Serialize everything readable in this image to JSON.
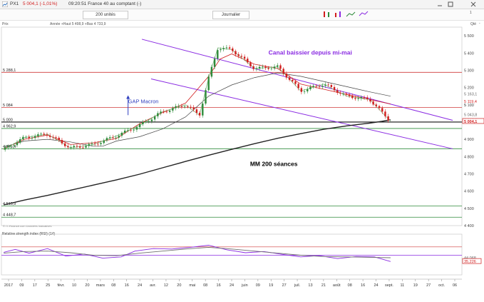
{
  "header": {
    "symbol": "PX1",
    "change": "5 004,1 (-1,01%)",
    "time_desc": "09:20:51 France 40 au comptant (-)",
    "units_label": "200 unités",
    "period_label": "Journalier",
    "window_count": "1"
  },
  "chart_header": {
    "code": "Prix",
    "ohlc_label": "Année +Haut 5 498,9 +Bas 4 733,9",
    "rsi_title": "Relative strength index (RSI) (14)",
    "credits": "© IT-Finance.com Données indicatives",
    "right_labels": [
      "Qté",
      "-"
    ]
  },
  "chart_data": {
    "type": "line",
    "title": "",
    "xlabel": "",
    "ylabel": "",
    "x_ticks": [
      "2017",
      "09",
      "17",
      "25",
      "févr.",
      "10",
      "20",
      "mars",
      "08",
      "16",
      "24",
      "avr.",
      "12",
      "20",
      "mai",
      "08",
      "16",
      "24",
      "juin",
      "09",
      "19",
      "27",
      "juil.",
      "13",
      "21",
      "août",
      "08",
      "16",
      "24",
      "sept.",
      "11",
      "19",
      "27",
      "oct.",
      "06"
    ],
    "ylim": [
      4400,
      5550
    ],
    "y_ticks": [
      "5 500",
      "5 400",
      "5 300",
      "5 200",
      "5 100",
      "5 000",
      "4 900",
      "4 800",
      "4 700",
      "4 600",
      "4 500",
      "4 400"
    ],
    "right_labels": [
      {
        "text": "5 163,1",
        "value": 5163.1,
        "color": "#666666"
      },
      {
        "text": "5 119,4",
        "value": 5119.4,
        "color": "#d11d1d"
      },
      {
        "text": "5 100",
        "value": 5100,
        "color": "#666666"
      },
      {
        "text": "5 043,8",
        "value": 5043.8,
        "color": "#666666"
      },
      {
        "text": "5 013,6",
        "value": 5013.6,
        "color": "#666666"
      },
      {
        "text": "5 004,1",
        "value": 5004.1,
        "color": "#d11d1d",
        "box": true
      }
    ],
    "horizontal_lines": [
      {
        "label": "5 288,1",
        "value": 5288.1,
        "color": "#d13b3b",
        "width": 0.8
      },
      {
        "label": "5 084",
        "value": 5084,
        "color": "#d13b3b",
        "width": 0.8
      },
      {
        "label": "5 000",
        "value": 5000,
        "color": "#111111",
        "width": 1.1
      },
      {
        "label": "4 962,9",
        "value": 4962.9,
        "color": "#2e8b3a",
        "width": 0.8
      },
      {
        "label": "4 845,4",
        "value": 4845.4,
        "color": "#2e8b3a",
        "width": 0.8
      },
      {
        "label": "4 513,9",
        "value": 4513.9,
        "color": "#2e8b3a",
        "width": 0.8
      },
      {
        "label": "4 448,7",
        "value": 4448.7,
        "color": "#2e8b3a",
        "width": 0.8
      }
    ],
    "channel": {
      "color": "#8a2be2",
      "upper": [
        [
          0.305,
          5480
        ],
        [
          0.98,
          5010
        ]
      ],
      "lower": [
        [
          0.325,
          5250
        ],
        [
          0.98,
          4845
        ]
      ]
    },
    "annotations": [
      {
        "text": "Canal baissier depuis mi-mai",
        "value": 5390,
        "xfrac": 0.58,
        "color": "#8a2be2",
        "bold": true
      },
      {
        "text": "GAP Macron",
        "value": 5110,
        "xfrac": 0.275,
        "color": "#2f3fbf",
        "bold": false
      },
      {
        "text": "MM 200 séances",
        "value": 4745,
        "xfrac": 0.54,
        "color": "#000000",
        "bold": true
      }
    ],
    "gap_arrow": {
      "xfrac": 0.275,
      "from": 5040,
      "to": 5155,
      "color": "#2f3fbf"
    },
    "series": [
      {
        "color": "#222222",
        "width": 1.4,
        "values": [
          [
            0.005,
            4520
          ],
          [
            0.05,
            4548
          ],
          [
            0.1,
            4575
          ],
          [
            0.15,
            4605
          ],
          [
            0.2,
            4635
          ],
          [
            0.25,
            4665
          ],
          [
            0.3,
            4698
          ],
          [
            0.35,
            4735
          ],
          [
            0.4,
            4772
          ],
          [
            0.45,
            4808
          ],
          [
            0.5,
            4842
          ],
          [
            0.55,
            4875
          ],
          [
            0.6,
            4906
          ],
          [
            0.65,
            4933
          ],
          [
            0.7,
            4958
          ],
          [
            0.75,
            4978
          ],
          [
            0.8,
            4994
          ],
          [
            0.826,
            5004
          ],
          [
            0.845,
            5013
          ]
        ]
      },
      {
        "color": "#444444",
        "width": 0.7,
        "values": [
          [
            0.005,
            4855
          ],
          [
            0.05,
            4890
          ],
          [
            0.1,
            4900
          ],
          [
            0.15,
            4885
          ],
          [
            0.2,
            4860
          ],
          [
            0.22,
            4860
          ],
          [
            0.25,
            4890
          ],
          [
            0.3,
            4915
          ],
          [
            0.35,
            4960
          ],
          [
            0.4,
            5030
          ],
          [
            0.45,
            5150
          ],
          [
            0.5,
            5215
          ],
          [
            0.55,
            5258
          ],
          [
            0.6,
            5285
          ],
          [
            0.65,
            5265
          ],
          [
            0.7,
            5235
          ],
          [
            0.75,
            5205
          ],
          [
            0.8,
            5175
          ],
          [
            0.845,
            5150
          ]
        ]
      },
      {
        "color": "#d11d1d",
        "width": 0.8,
        "values": [
          [
            0.005,
            4845
          ],
          [
            0.05,
            4900
          ],
          [
            0.1,
            4925
          ],
          [
            0.15,
            4870
          ],
          [
            0.2,
            4880
          ],
          [
            0.25,
            4905
          ],
          [
            0.3,
            4990
          ],
          [
            0.35,
            5055
          ],
          [
            0.4,
            5110
          ],
          [
            0.45,
            5265
          ],
          [
            0.475,
            5365
          ],
          [
            0.5,
            5395
          ],
          [
            0.55,
            5335
          ],
          [
            0.6,
            5310
          ],
          [
            0.65,
            5220
          ],
          [
            0.7,
            5190
          ],
          [
            0.75,
            5160
          ],
          [
            0.8,
            5130
          ],
          [
            0.845,
            5105
          ]
        ]
      },
      {
        "color": "#8cc08c",
        "width": 0.9,
        "values": [
          [
            0.005,
            4840
          ],
          [
            0.05,
            4910
          ],
          [
            0.1,
            4930
          ],
          [
            0.15,
            4850
          ],
          [
            0.2,
            4870
          ],
          [
            0.25,
            4920
          ],
          [
            0.3,
            4980
          ],
          [
            0.35,
            5060
          ],
          [
            0.4,
            5100
          ],
          [
            0.43,
            5040
          ],
          [
            0.45,
            5255
          ],
          [
            0.47,
            5430
          ],
          [
            0.5,
            5420
          ],
          [
            0.55,
            5310
          ],
          [
            0.6,
            5320
          ],
          [
            0.65,
            5180
          ],
          [
            0.7,
            5220
          ],
          [
            0.75,
            5150
          ],
          [
            0.8,
            5130
          ],
          [
            0.845,
            5004
          ]
        ]
      }
    ],
    "rsi": {
      "ylim": [
        20,
        80
      ],
      "label": "Relative strength index (RSI) (14)",
      "ticks": [
        {
          "text": "44,068",
          "value": 44.068,
          "color": "#666666"
        },
        {
          "text": "35,226",
          "value": 35.226,
          "color": "#d11d1d",
          "box": true
        }
      ],
      "levels": [
        {
          "value": 70,
          "color": "#d13b3b"
        },
        {
          "value": 50,
          "color": "#8a2be2"
        }
      ],
      "series": [
        {
          "color": "#8a2be2",
          "values": [
            [
              0.005,
              57
            ],
            [
              0.03,
              64
            ],
            [
              0.06,
              55
            ],
            [
              0.1,
              66
            ],
            [
              0.14,
              48
            ],
            [
              0.18,
              53
            ],
            [
              0.22,
              43
            ],
            [
              0.26,
              46
            ],
            [
              0.29,
              60
            ],
            [
              0.33,
              66
            ],
            [
              0.37,
              65
            ],
            [
              0.41,
              69
            ],
            [
              0.45,
              74
            ],
            [
              0.49,
              63
            ],
            [
              0.53,
              56
            ],
            [
              0.57,
              59
            ],
            [
              0.61,
              52
            ],
            [
              0.65,
              46
            ],
            [
              0.69,
              49
            ],
            [
              0.73,
              42
            ],
            [
              0.77,
              47
            ],
            [
              0.81,
              46
            ],
            [
              0.845,
              35
            ]
          ]
        },
        {
          "color": "#707070",
          "values": [
            [
              0.005,
              55
            ],
            [
              0.05,
              59
            ],
            [
              0.1,
              60
            ],
            [
              0.15,
              56
            ],
            [
              0.2,
              50
            ],
            [
              0.25,
              49
            ],
            [
              0.3,
              55
            ],
            [
              0.35,
              60
            ],
            [
              0.4,
              65
            ],
            [
              0.45,
              69
            ],
            [
              0.5,
              65
            ],
            [
              0.55,
              60
            ],
            [
              0.6,
              55
            ],
            [
              0.65,
              50
            ],
            [
              0.7,
              47
            ],
            [
              0.75,
              46
            ],
            [
              0.8,
              45
            ],
            [
              0.845,
              44
            ]
          ]
        }
      ]
    }
  }
}
